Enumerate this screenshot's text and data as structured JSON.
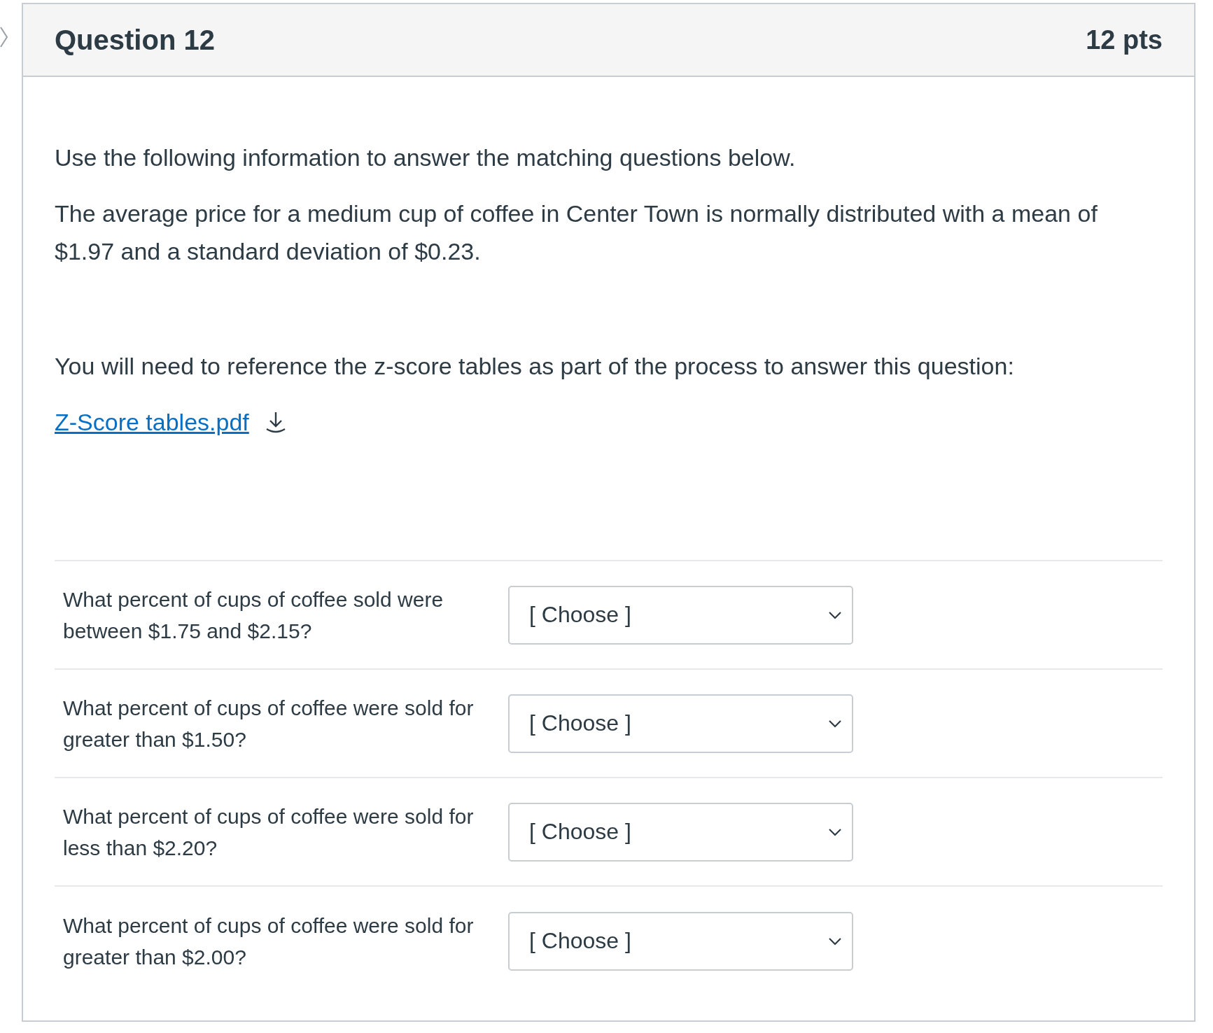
{
  "question": {
    "title": "Question 12",
    "points": "12 pts"
  },
  "paragraphs": [
    "Use the following information to answer the matching questions below.",
    "The average price for a medium cup of coffee in Center Town is normally distributed with a mean of $1.97 and a standard deviation of $0.23.",
    "You will need to reference the z-score tables as part of the process to answer this question:"
  ],
  "attachment": {
    "label": "Z-Score tables.pdf"
  },
  "matches": [
    {
      "prompt": "What percent of cups of coffee sold were between $1.75 and $2.15?",
      "value": "[ Choose ]"
    },
    {
      "prompt": "What percent of cups of coffee were sold for greater than $1.50?",
      "value": "[ Choose ]"
    },
    {
      "prompt": "What percent of cups of coffee were sold for less than $2.20?",
      "value": "[ Choose ]"
    },
    {
      "prompt": "What percent of cups of coffee were sold for greater than $2.00?",
      "value": "[ Choose ]"
    }
  ]
}
